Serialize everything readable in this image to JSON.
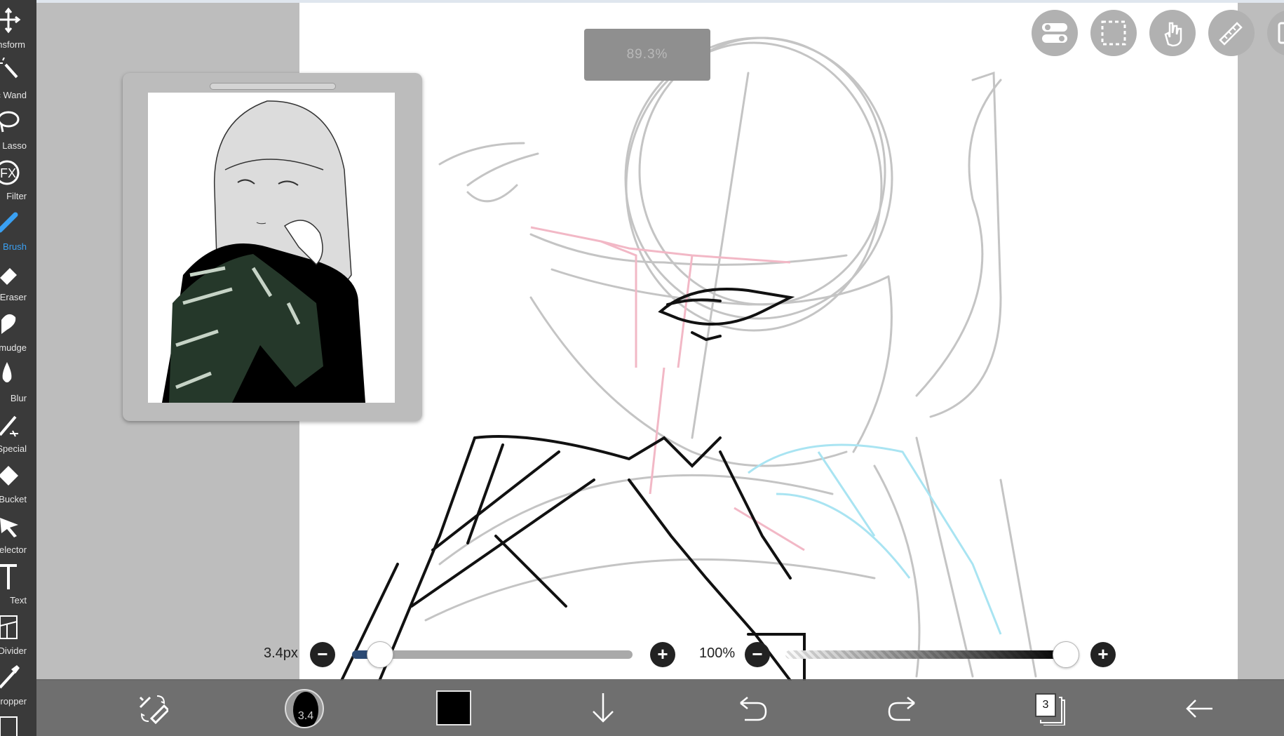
{
  "toolbar": {
    "tools": [
      {
        "label": "Transform",
        "icon": "move-arrows-icon"
      },
      {
        "label": "Magic Wand",
        "icon": "magic-wand-icon"
      },
      {
        "label": "Lasso",
        "icon": "lasso-icon"
      },
      {
        "label": "Filter",
        "icon": "fx-icon"
      },
      {
        "label": "Brush",
        "icon": "brush-icon",
        "active": true
      },
      {
        "label": "Eraser",
        "icon": "eraser-icon"
      },
      {
        "label": "Smudge",
        "icon": "smudge-icon"
      },
      {
        "label": "Blur",
        "icon": "drop-icon"
      },
      {
        "label": "Special",
        "icon": "special-wand-icon"
      },
      {
        "label": "Bucket",
        "icon": "bucket-icon"
      },
      {
        "label": "Selector",
        "icon": "selector-arrow-icon"
      },
      {
        "label": "Text",
        "icon": "text-icon"
      },
      {
        "label": "Frame Divider",
        "icon": "frame-divider-icon"
      },
      {
        "label": "Eyedropper",
        "icon": "eyedropper-icon"
      }
    ]
  },
  "zoom": {
    "value": "89.3%"
  },
  "top_buttons": [
    "toggle-icon",
    "selection-icon",
    "hand-icon",
    "ruler-icon",
    "layers-panel-icon"
  ],
  "brush_size": {
    "label": "3.4px",
    "value_fraction": 0.1
  },
  "opacity": {
    "label": "100%",
    "value_fraction": 1.0
  },
  "bottom_bar": {
    "brush_thumb_number": "3.4",
    "color": "#000000",
    "layer_count": "3",
    "icons": [
      "swap-tools-icon",
      "brush-thumbnail-icon",
      "color-swatch-icon",
      "import-down-arrow-icon",
      "undo-icon",
      "redo-icon",
      "layers-icon",
      "back-arrow-icon"
    ]
  },
  "colors": {
    "accent": "#3aa0f2",
    "toolbar_bg": "#3a3a3a",
    "sketch_pink": "#f2b8c6",
    "sketch_cyan": "#a9e4f2"
  }
}
